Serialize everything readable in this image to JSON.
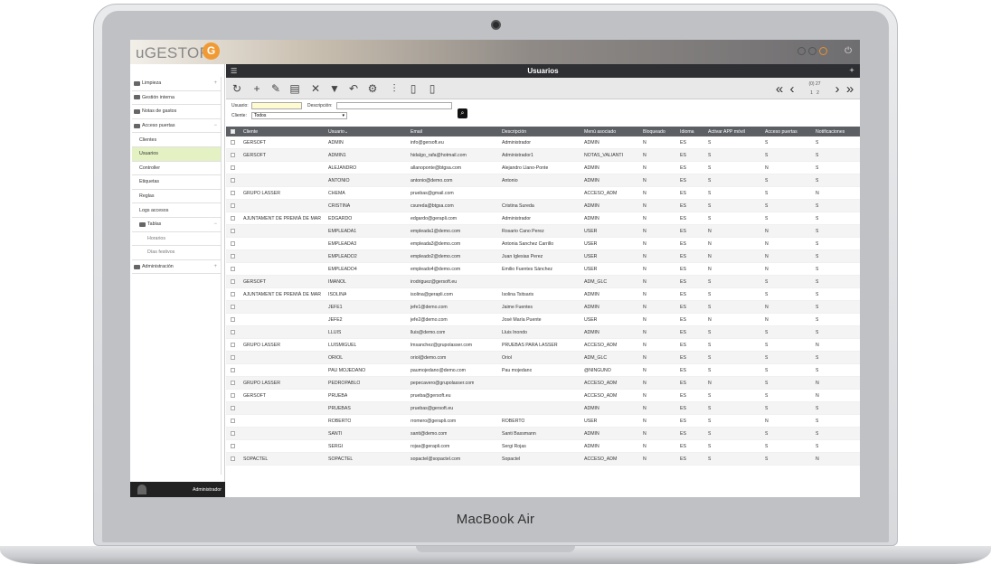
{
  "device": {
    "label": "MacBook Air"
  },
  "app": {
    "logo_prefix": "u",
    "logo_main": "GESTOR",
    "logo_mark": "G"
  },
  "window": {
    "title": "Usuarios"
  },
  "sidebar": {
    "items": [
      {
        "label": "Limpieza",
        "level": 0,
        "toggle": "+"
      },
      {
        "label": "Gestión interna",
        "level": 0,
        "toggle": ""
      },
      {
        "label": "Notas de gastos",
        "level": 0,
        "toggle": ""
      },
      {
        "label": "Acceso puertas",
        "level": 0,
        "toggle": "−"
      },
      {
        "label": "Clientes",
        "level": 1,
        "toggle": ""
      },
      {
        "label": "Usuarios",
        "level": 1,
        "toggle": "",
        "active": true
      },
      {
        "label": "Controller",
        "level": 1,
        "toggle": ""
      },
      {
        "label": "Etiquetas",
        "level": 1,
        "toggle": ""
      },
      {
        "label": "Reglas",
        "level": 1,
        "toggle": ""
      },
      {
        "label": "Logs accesos",
        "level": 1,
        "toggle": ""
      },
      {
        "label": "Tablas",
        "level": 1,
        "toggle": "−",
        "folder": true
      },
      {
        "label": "Horarios",
        "level": 2,
        "toggle": ""
      },
      {
        "label": "Días festivos",
        "level": 2,
        "toggle": ""
      },
      {
        "label": "Administración",
        "level": 0,
        "toggle": "+"
      }
    ],
    "footer_user": "Administrador"
  },
  "toolbar": {
    "icons": [
      "refresh-icon",
      "add-icon",
      "edit-icon",
      "clipboard-icon",
      "delete-icon",
      "filter-icon",
      "undo-icon",
      "settings-icon",
      "attach-icon",
      "document-icon",
      "excel-icon"
    ],
    "glyphs": [
      "↻",
      "+",
      "✎",
      "▤",
      "✕",
      "▼",
      "↶",
      "⚙",
      "⫶",
      "▯",
      "▯"
    ]
  },
  "pager": {
    "count": "(0) 27",
    "pages": [
      "1",
      "2"
    ]
  },
  "filters": {
    "usuario_label": "Usuario:",
    "descripcion_label": "Descripción:",
    "cliente_label": "Cliente:",
    "cliente_value": "Todos"
  },
  "table": {
    "columns": [
      "Cliente",
      "Usuario",
      "Email",
      "Descripción",
      "Menú asociado",
      "Bloqueado",
      "Idioma",
      "Activar APP móvil",
      "Acceso puertas",
      "Notificaciones"
    ],
    "sort_column": "Usuario",
    "rows": [
      [
        "GERSOFT",
        "ADMIN",
        "info@gersoft.eu",
        "Administrador",
        "ADMIN",
        "N",
        "ES",
        "S",
        "S",
        "S"
      ],
      [
        "GERSOFT",
        "ADMIN1",
        "hidalgo_rafa@hotmail.com",
        "Administrador1",
        "NOTAS_VALIANTI",
        "N",
        "ES",
        "S",
        "S",
        "S"
      ],
      [
        "",
        "ALEJANDRO",
        "allanoponte@btgsa.com",
        "Alejandro Llano-Ponte",
        "ADMIN",
        "N",
        "ES",
        "S",
        "N",
        "S"
      ],
      [
        "",
        "ANTONIO",
        "antonio@demo.com",
        "Antonio",
        "ADMIN",
        "N",
        "ES",
        "S",
        "S",
        "S"
      ],
      [
        "GRUPO LASSER",
        "CHEMA",
        "pruebas@gmail.com",
        "",
        "ACCESO_ADM",
        "N",
        "ES",
        "S",
        "S",
        "N"
      ],
      [
        "",
        "CRISTINA",
        "csureda@btgsa.com",
        "Cristina Sureda",
        "ADMIN",
        "N",
        "ES",
        "S",
        "S",
        "S"
      ],
      [
        "AJUNTAMENT DE PREMIÀ DE MAR",
        "EDGARDO",
        "edgardo@gerapli.com",
        "Administrador",
        "ADMIN",
        "N",
        "ES",
        "S",
        "S",
        "S"
      ],
      [
        "",
        "EMPLEADA1",
        "empleada1@demo.com",
        "Rosario Cano Perez",
        "USER",
        "N",
        "ES",
        "N",
        "N",
        "S"
      ],
      [
        "",
        "EMPLEADA3",
        "empleada3@demo.com",
        "Antonia Sanchez Carrillo",
        "USER",
        "N",
        "ES",
        "N",
        "N",
        "S"
      ],
      [
        "",
        "EMPLEADO2",
        "empleado2@demo.com",
        "Juan Iglesias Perez",
        "USER",
        "N",
        "ES",
        "N",
        "N",
        "S"
      ],
      [
        "",
        "EMPLEADO4",
        "empleado4@demo.com",
        "Emilio Fuentes Sánchez",
        "USER",
        "N",
        "ES",
        "N",
        "N",
        "S"
      ],
      [
        "GERSOFT",
        "IMANOL",
        "irodriguez@gersoft.eu",
        "",
        "ADM_GLC",
        "N",
        "ES",
        "S",
        "S",
        "S"
      ],
      [
        "AJUNTAMENT DE PREMIÀ DE MAR",
        "ISOLINA",
        "isolina@gerapli.com",
        "Isolina Tsitsaris",
        "ADMIN",
        "N",
        "ES",
        "S",
        "S",
        "S"
      ],
      [
        "",
        "JEFE1",
        "jefe1@demo.com",
        "Jaime Fuentes",
        "ADMIN",
        "N",
        "ES",
        "S",
        "N",
        "S"
      ],
      [
        "",
        "JEFE2",
        "jefe2@demo.com",
        "José María Puente",
        "USER",
        "N",
        "ES",
        "N",
        "N",
        "S"
      ],
      [
        "",
        "LLUIS",
        "lluis@demo.com",
        "Lluis Inondo",
        "ADMIN",
        "N",
        "ES",
        "S",
        "S",
        "S"
      ],
      [
        "GRUPO LASSER",
        "LUISMIGUEL",
        "lmsanchez@grupolasser.com",
        "PRUEBAS PARA LASSER",
        "ACCESO_ADM",
        "N",
        "ES",
        "S",
        "S",
        "N"
      ],
      [
        "",
        "ORIOL",
        "oriol@demo.com",
        "Oriol",
        "ADM_GLC",
        "N",
        "ES",
        "S",
        "S",
        "S"
      ],
      [
        "",
        "PAU MOJEDANO",
        "paumojedano@demo.com",
        "Pau mojedano",
        "@NINGUNO",
        "N",
        "ES",
        "S",
        "S",
        "S"
      ],
      [
        "GRUPO LASSER",
        "PEDROPABLO",
        "pepecavero@grupolasser.com",
        "",
        "ACCESO_ADM",
        "N",
        "ES",
        "N",
        "S",
        "N"
      ],
      [
        "GERSOFT",
        "PRUEBA",
        "prueba@gersoft.eu",
        "",
        "ACCESO_ADM",
        "N",
        "ES",
        "S",
        "S",
        "N"
      ],
      [
        "",
        "PRUEBAS",
        "pruebas@gersoft.eu",
        "",
        "ADMIN",
        "N",
        "ES",
        "S",
        "S",
        "S"
      ],
      [
        "",
        "ROBERTO",
        "rromero@gerapli.com",
        "ROBERTO",
        "USER",
        "N",
        "ES",
        "S",
        "N",
        "S"
      ],
      [
        "",
        "SANTI",
        "santi@demo.com",
        "Santi Bassmann",
        "ADMIN",
        "N",
        "ES",
        "S",
        "S",
        "S"
      ],
      [
        "",
        "SERGI",
        "rojas@gerapli.com",
        "Sergi Rojas",
        "ADMIN",
        "N",
        "ES",
        "S",
        "S",
        "S"
      ],
      [
        "SOPACTEL",
        "SOPACTEL",
        "sopactel@sopactel.com",
        "Sopactel",
        "ACCESO_ADM",
        "N",
        "ES",
        "S",
        "S",
        "N"
      ]
    ]
  },
  "colors": {
    "accent": "#e8922c",
    "active_row": "#e3f1c3",
    "header": "#5c5f64",
    "titlebar": "#2e2f32"
  }
}
